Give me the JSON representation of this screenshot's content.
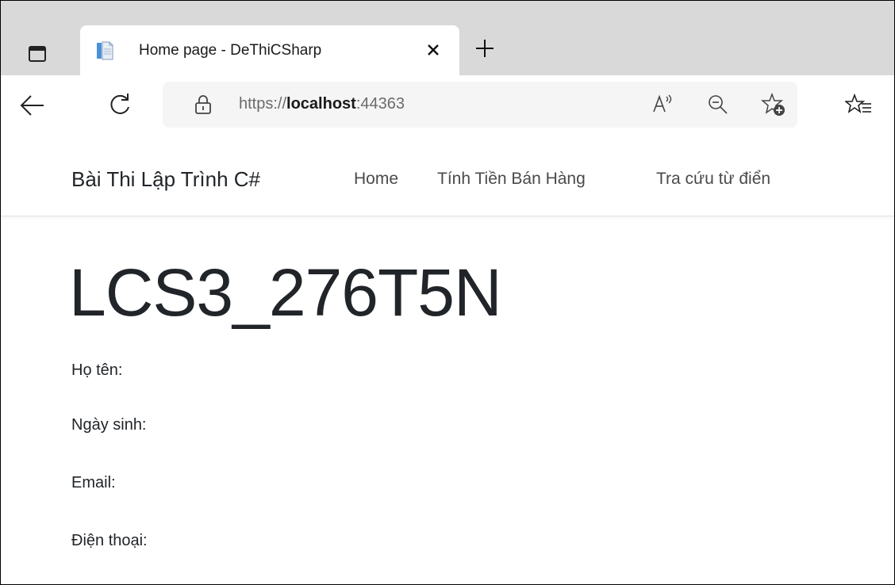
{
  "browser": {
    "tab_title": "Home page - DeThiCSharp",
    "tab_close": "×",
    "new_tab": "+",
    "url_scheme": "https://",
    "url_host": "localhost",
    "url_port": ":44363",
    "icons": [
      "tab-actions-icon",
      "page-favicon-icon",
      "close-icon",
      "plus-icon",
      "back-arrow-icon",
      "refresh-icon",
      "lock-icon",
      "read-aloud-icon",
      "zoom-out-icon",
      "add-favorite-icon",
      "favorites-icon"
    ],
    "tabstrip_color": "#d9d9d9"
  },
  "navbar": {
    "brand": "Bài Thi Lập Trình C#",
    "links": [
      "Home",
      "Tính Tiền Bán Hàng",
      "Tra cứu từ điển"
    ]
  },
  "main": {
    "heading": "LCS3_276T5N",
    "fields": [
      "Họ tên:",
      "Ngày sinh:",
      "Email:",
      "Điện thoại:"
    ]
  }
}
